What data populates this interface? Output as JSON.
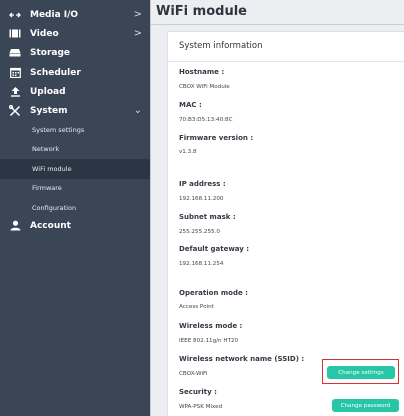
{
  "sidebar": {
    "items": [
      {
        "label": "Media I/O",
        "icon": "media-io-icon",
        "chevron": ">"
      },
      {
        "label": "Video",
        "icon": "video-icon",
        "chevron": ">"
      },
      {
        "label": "Storage",
        "icon": "storage-icon"
      },
      {
        "label": "Scheduler",
        "icon": "calendar-icon"
      },
      {
        "label": "Upload",
        "icon": "upload-icon"
      },
      {
        "label": "System",
        "icon": "tools-icon",
        "chevron": "⌄"
      },
      {
        "label": "Account",
        "icon": "user-icon"
      }
    ],
    "system_sub": [
      "System settings",
      "Network",
      "WiFi module",
      "Firmware",
      "Configuration"
    ],
    "active_sub": "WiFi module"
  },
  "main": {
    "title": "WiFi module",
    "card_title": "System information",
    "fields": {
      "hostname": {
        "label": "Hostname :",
        "value": "CBOX WiFi Module"
      },
      "mac": {
        "label": "MAC :",
        "value": "70:B3:D5:13:40:8C"
      },
      "firmware": {
        "label": "Firmware version :",
        "value": "v1.3.8"
      },
      "ip": {
        "label": "IP address :",
        "value": "192.168.11.200"
      },
      "subnet": {
        "label": "Subnet mask :",
        "value": "255.255.255.0"
      },
      "gateway": {
        "label": "Default gateway :",
        "value": "192.168.11.254"
      },
      "mode": {
        "label": "Operation mode :",
        "value": "Access Point"
      },
      "wireless_mode": {
        "label": "Wireless mode :",
        "value": "IEEE 802.11g/n HT20"
      },
      "ssid": {
        "label": "Wireless network name (SSID) :",
        "value": "CBOX-WiFi"
      },
      "security": {
        "label": "Security :",
        "value": "WPA-PSK Mixed"
      }
    },
    "buttons": {
      "change_settings": "Change settings",
      "change_password": "Change password"
    }
  },
  "colors": {
    "sidebar_bg": "#3a4656",
    "sidebar_active": "#2b3544",
    "accent": "#26c6a6",
    "highlight": "#d8312f"
  }
}
